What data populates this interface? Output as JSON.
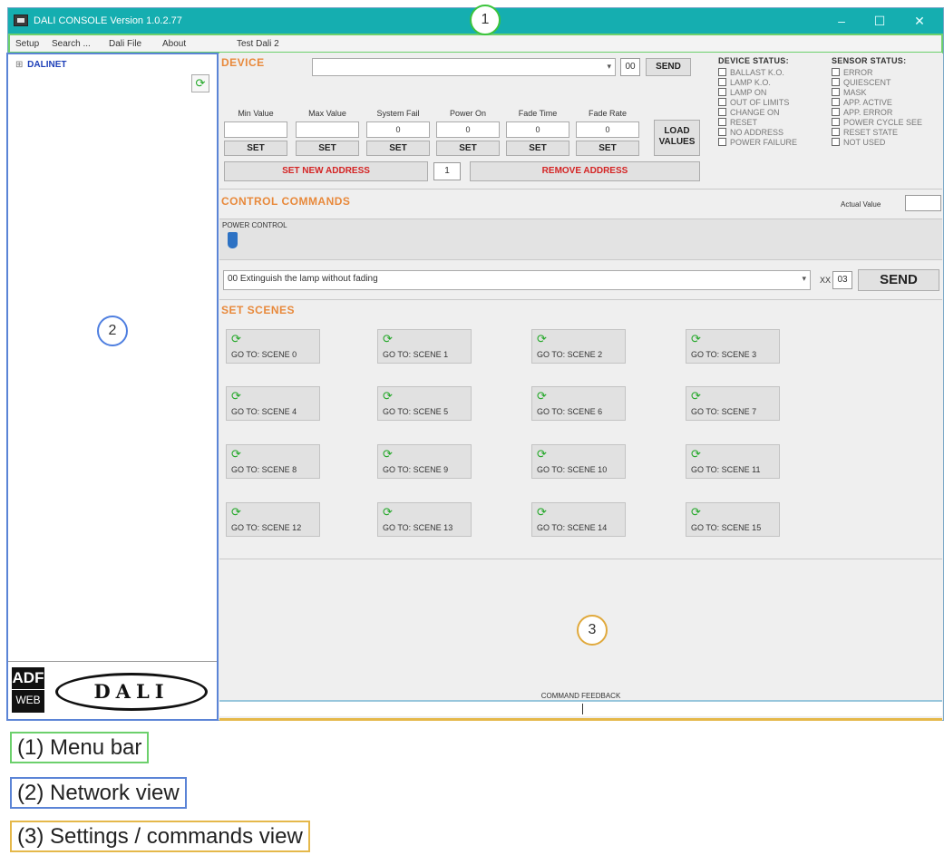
{
  "window": {
    "title": "DALI CONSOLE Version 1.0.2.77",
    "minimize": "–",
    "maximize": "☐",
    "close": "✕"
  },
  "menu": {
    "items": [
      "Setup",
      "Search ...",
      "Dali File",
      "About",
      "Test Dali 2"
    ]
  },
  "network": {
    "root_label": "DALINET",
    "expander": "⊞",
    "refresh_icon": "refresh-icon"
  },
  "device": {
    "title": "DEVICE",
    "select_value": "",
    "address": "00",
    "send_label": "SEND",
    "params": [
      {
        "label": "Min Value",
        "value": "",
        "set": "SET"
      },
      {
        "label": "Max Value",
        "value": "",
        "set": "SET"
      },
      {
        "label": "System Fail",
        "value": "0",
        "set": "SET"
      },
      {
        "label": "Power On",
        "value": "0",
        "set": "SET"
      },
      {
        "label": "Fade Time",
        "value": "0",
        "set": "SET"
      },
      {
        "label": "Fade Rate",
        "value": "0",
        "set": "SET"
      }
    ],
    "load_values_1": "LOAD",
    "load_values_2": "VALUES",
    "set_new_address": "SET NEW ADDRESS",
    "new_address_value": "1",
    "remove_address": "REMOVE ADDRESS"
  },
  "device_status": {
    "title": "DEVICE STATUS:",
    "items": [
      "BALLAST K.O.",
      "LAMP K.O.",
      "LAMP ON",
      "OUT OF LIMITS",
      "CHANGE ON",
      "RESET",
      "NO ADDRESS",
      "POWER FAILURE"
    ]
  },
  "sensor_status": {
    "title": "SENSOR STATUS:",
    "items": [
      "ERROR",
      "QUIESCENT",
      "MASK",
      "APP. ACTIVE",
      "APP. ERROR",
      "POWER CYCLE SEE",
      "RESET STATE",
      "NOT USED"
    ]
  },
  "control": {
    "title": "CONTROL COMMANDS",
    "actual_value_label": "Actual Value",
    "actual_value": "",
    "power_control_label": "POWER CONTROL",
    "power_level": 0,
    "command_value": "00 Extinguish the lamp without fading",
    "xx_label": "XX",
    "xx_value": "03",
    "send_label": "SEND"
  },
  "scenes": {
    "title": "SET SCENES",
    "items": [
      "GO TO: SCENE 0",
      "GO TO: SCENE 1",
      "GO TO: SCENE 2",
      "GO TO: SCENE 3",
      "GO TO: SCENE 4",
      "GO TO: SCENE 5",
      "GO TO: SCENE 6",
      "GO TO: SCENE 7",
      "GO TO: SCENE 8",
      "GO TO: SCENE 9",
      "GO TO: SCENE 10",
      "GO TO: SCENE 11",
      "GO TO: SCENE 12",
      "GO TO: SCENE 13",
      "GO TO: SCENE 14",
      "GO TO: SCENE 15"
    ]
  },
  "feedback": {
    "label": "COMMAND FEEDBACK"
  },
  "markers": {
    "m1": "1",
    "m2": "2",
    "m3": "3",
    "m1_color": "#3cc43c",
    "m2_color": "#4f7fe0",
    "m3_color": "#e0a93c"
  },
  "legend": {
    "menu_bar": "(1) Menu bar",
    "network_view": "(2) Network view",
    "settings_view": "(3) Settings / commands view",
    "menu_color": "#6cd06c",
    "network_color": "#5b84d6",
    "settings_color": "#e5b84a"
  }
}
